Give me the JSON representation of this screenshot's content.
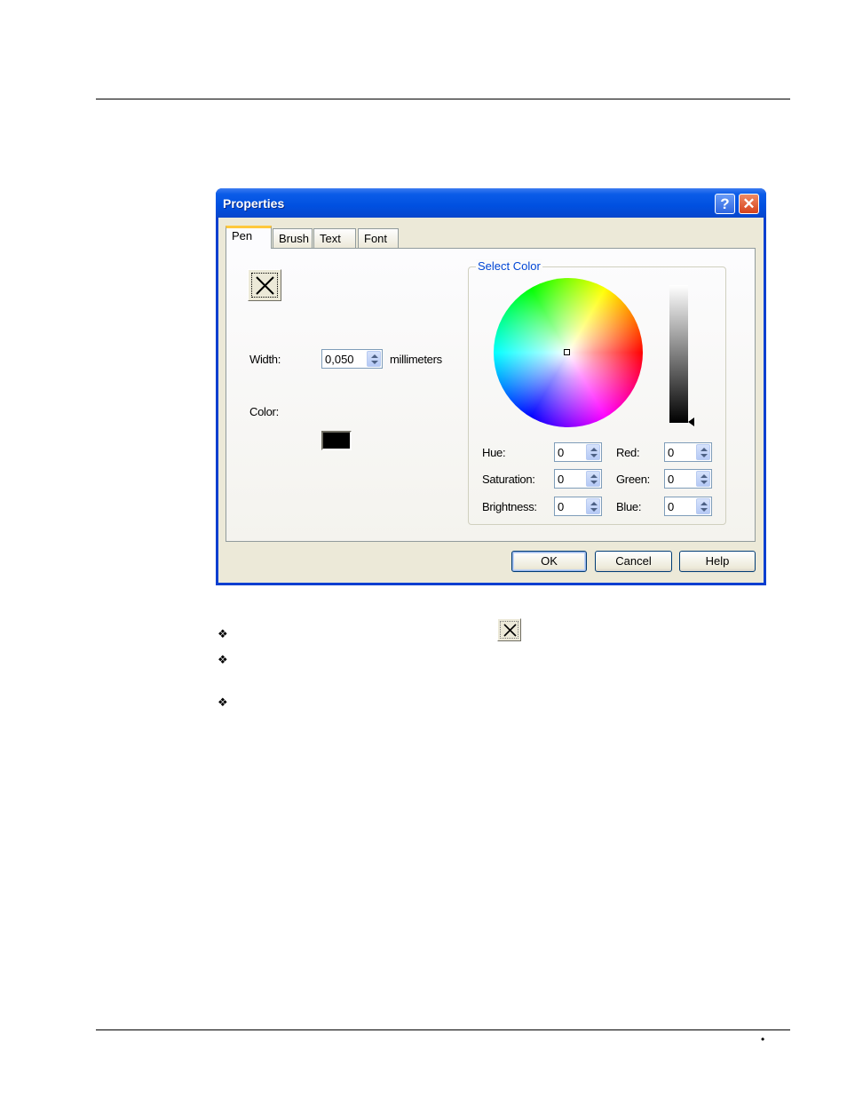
{
  "dialog": {
    "title": "Properties",
    "help_button": "?",
    "close_button": "✕",
    "tabs": [
      {
        "label": "Pen",
        "active": true
      },
      {
        "label": "Brush",
        "active": false
      },
      {
        "label": "Text",
        "active": false
      },
      {
        "label": "Font",
        "active": false
      }
    ],
    "pen": {
      "style_button_icon": "x-icon",
      "width_label": "Width:",
      "width_value": "0,050",
      "width_unit": "millimeters",
      "color_label": "Color:",
      "color_value": "#000000"
    },
    "select_color": {
      "group_title": "Select Color",
      "brightness_level": 0,
      "fields": {
        "hue": {
          "label": "Hue:",
          "value": "0"
        },
        "saturation": {
          "label": "Saturation:",
          "value": "0"
        },
        "brightness": {
          "label": "Brightness:",
          "value": "0"
        },
        "red": {
          "label": "Red:",
          "value": "0"
        },
        "green": {
          "label": "Green:",
          "value": "0"
        },
        "blue": {
          "label": "Blue:",
          "value": "0"
        }
      }
    },
    "buttons": {
      "ok": "OK",
      "cancel": "Cancel",
      "help": "Help"
    }
  },
  "document": {
    "bullets": [
      "❖",
      "❖",
      "❖"
    ],
    "footer_mark": "•"
  }
}
